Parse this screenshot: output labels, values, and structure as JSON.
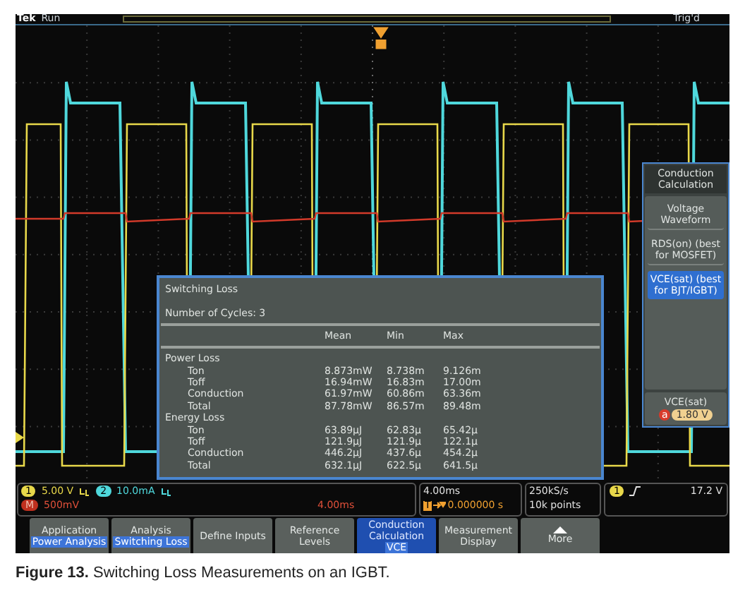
{
  "top_bar": {
    "brand": "Tek",
    "state": "Run",
    "trigger_status": "Trig'd"
  },
  "measurement_panel": {
    "title": "Switching Loss",
    "cycles": "Number of Cycles: 3",
    "columns": [
      "Mean",
      "Min",
      "Max"
    ],
    "groups": [
      {
        "label": "Power Loss",
        "rows": [
          {
            "label": "Ton",
            "values": [
              "8.873mW",
              "8.738m",
              "9.126m"
            ]
          },
          {
            "label": "Toff",
            "values": [
              "16.94mW",
              "16.83m",
              "17.00m"
            ]
          },
          {
            "label": "Conduction",
            "values": [
              "61.97mW",
              "60.86m",
              "63.36m"
            ]
          },
          {
            "label": "Total",
            "values": [
              "87.78mW",
              "86.57m",
              "89.48m"
            ]
          }
        ]
      },
      {
        "label": "Energy Loss",
        "rows": [
          {
            "label": "Ton",
            "values": [
              "63.89µJ",
              "62.83µ",
              "65.42µ"
            ]
          },
          {
            "label": "Toff",
            "values": [
              "121.9µJ",
              "121.9µ",
              "122.1µ"
            ]
          },
          {
            "label": "Conduction",
            "values": [
              "446.2µJ",
              "437.6µ",
              "454.2µ"
            ]
          },
          {
            "label": "Total",
            "values": [
              "632.1µJ",
              "622.5µ",
              "641.5µ"
            ]
          }
        ]
      }
    ]
  },
  "side_menu": {
    "title": "Conduction Calculation",
    "options": [
      {
        "label": "Voltage Waveform",
        "selected": false
      },
      {
        "label": "RDS(on) (best for MOSFET)",
        "selected": false
      },
      {
        "label": "VCE(sat) (best for BJT/IGBT)",
        "selected": true
      }
    ],
    "value_item": {
      "label": "VCE(sat)",
      "badge": "a",
      "value": "1.80 V"
    }
  },
  "readouts": {
    "channels": [
      {
        "badge": "1",
        "scale": "5.00 V",
        "color": "#e8d84a"
      },
      {
        "badge": "2",
        "scale": "10.0mA",
        "color": "#4fd8dc"
      }
    ],
    "math": {
      "badge": "M",
      "scale": "500mV",
      "time": "4.00ms"
    },
    "horizontal": {
      "scale": "4.00ms",
      "badge": "T",
      "position": "0.000000 s"
    },
    "acquisition": {
      "rate": "250kS/s",
      "points": "10k points"
    },
    "trigger": {
      "badge": "1",
      "level": "17.2 V"
    }
  },
  "softkeys": [
    {
      "label": "Application",
      "value": "Power Analysis",
      "selected": false
    },
    {
      "label": "Analysis",
      "value": "Switching Loss",
      "selected": false
    },
    {
      "label": "Define Inputs",
      "selected": false
    },
    {
      "label": "Reference Levels",
      "selected": false
    },
    {
      "label": "Conduction Calculation",
      "value": "VCE",
      "selected": true
    },
    {
      "label": "Measurement Display",
      "selected": false
    },
    {
      "label": "More",
      "kind": "more",
      "selected": false
    }
  ],
  "caption": "**Figure 13.** Switching Loss Measurements on an IGBT."
}
